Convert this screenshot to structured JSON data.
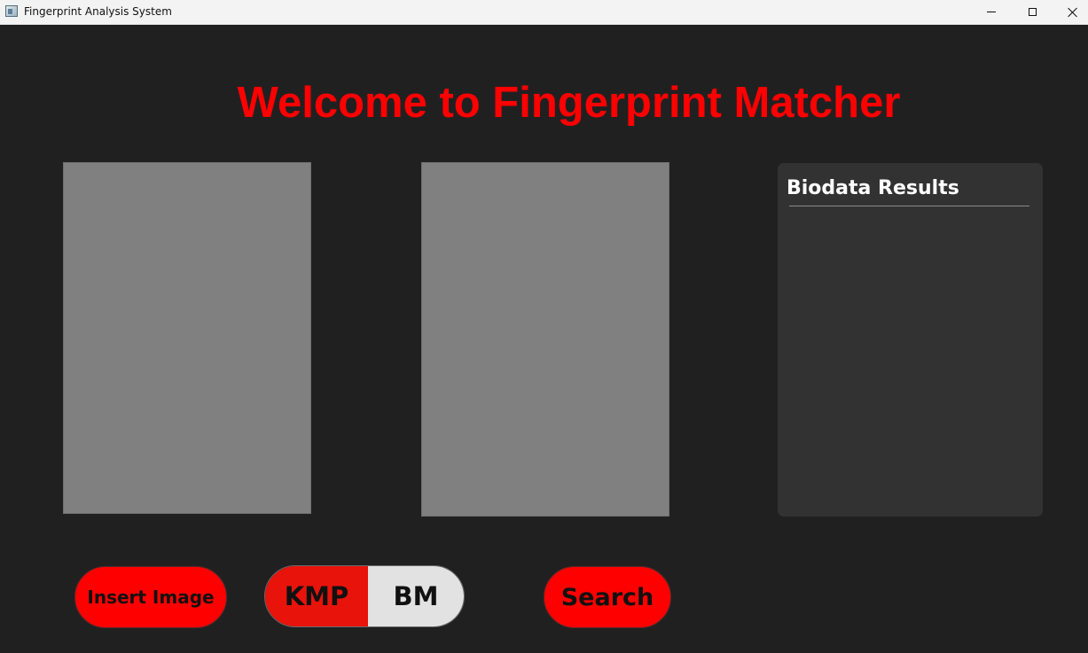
{
  "window": {
    "title": "Fingerprint Analysis System"
  },
  "main": {
    "heading": "Welcome to Fingerprint Matcher",
    "results": {
      "title": "Biodata Results"
    }
  },
  "controls": {
    "insert_label": "Insert Image",
    "algorithm_options": [
      "KMP",
      "BM"
    ],
    "selected_algorithm": "KMP",
    "search_label": "Search"
  },
  "colors": {
    "background": "#212021",
    "accent": "#ff0000",
    "toggle_selected": "#e8130b",
    "toggle_unselected": "#e2e2e2",
    "image_placeholder": "#808080",
    "results_panel": "#333233"
  },
  "icons": {
    "app": "app-window-icon",
    "minimize": "minimize-icon",
    "maximize": "maximize-icon",
    "close": "close-icon"
  }
}
